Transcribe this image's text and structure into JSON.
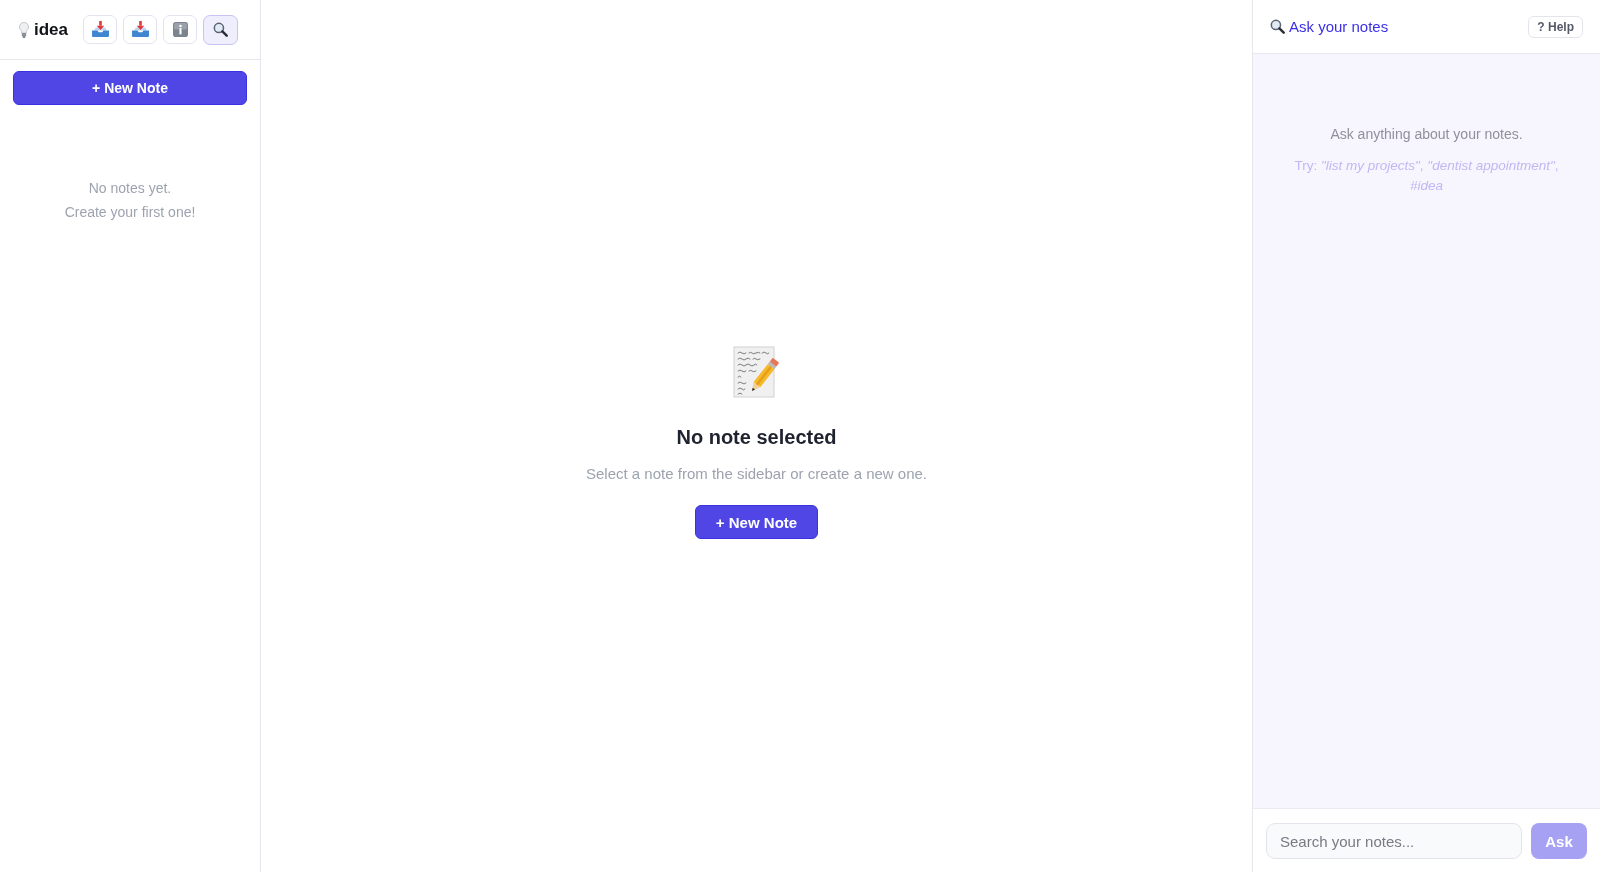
{
  "sidebar": {
    "logo": {
      "text": "idea"
    },
    "toolbar": [
      {
        "kind": "tray",
        "selected": false
      },
      {
        "kind": "tray",
        "selected": false
      },
      {
        "kind": "info",
        "selected": false
      },
      {
        "kind": "search",
        "selected": true
      }
    ],
    "new_note_button": "+ New Note",
    "empty_state": [
      "No notes yet.",
      "Create your first one!"
    ]
  },
  "main": {
    "empty_state": {
      "title": "No note selected",
      "message": "Select a note from the sidebar or create a new one.",
      "button": "+ New Note"
    }
  },
  "assistant": {
    "title": "Ask your notes",
    "help_button": "? Help",
    "intro": "Ask anything about your notes.",
    "suggestions": "Try: *\"list my projects\"*, *\"dentist appointment\"*, *#idea*",
    "search": {
      "placeholder": "Search your notes..."
    },
    "ask_button": {
      "label": "Ask",
      "disabled": true
    }
  }
}
